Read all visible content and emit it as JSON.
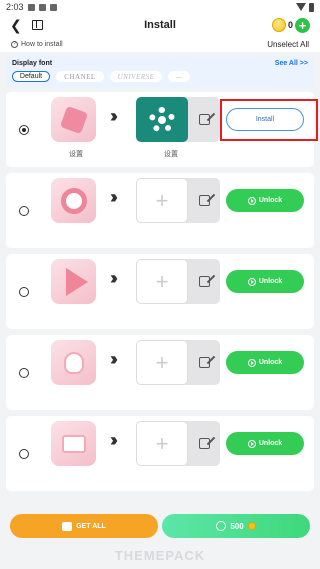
{
  "status": {
    "time": "2:03"
  },
  "header": {
    "title": "Install",
    "coins": "0"
  },
  "subheader": {
    "how_to": "How to install",
    "unselect": "Unselect All"
  },
  "font_panel": {
    "label": "Display font",
    "see_all": "See All >>",
    "chips": [
      "Default",
      "CHANEL",
      "UNIVERSE",
      "..."
    ]
  },
  "rows": [
    {
      "src_label": "设置",
      "tgt_label": "设置",
      "action": "Install"
    },
    {
      "src_label": "",
      "tgt_label": "",
      "action": "Unlock"
    },
    {
      "src_label": "",
      "tgt_label": "",
      "action": "Unlock"
    },
    {
      "src_label": "",
      "tgt_label": "",
      "action": "Unlock"
    },
    {
      "src_label": "",
      "tgt_label": "",
      "action": "Unlock"
    }
  ],
  "bottom": {
    "get_all": "GET ALL",
    "price": "500"
  },
  "watermark": "THEMEPACK",
  "colors": {
    "accent_green": "#33cc55",
    "accent_orange": "#f5a425",
    "link_blue": "#1a73e8",
    "highlight_red": "#e02020"
  }
}
